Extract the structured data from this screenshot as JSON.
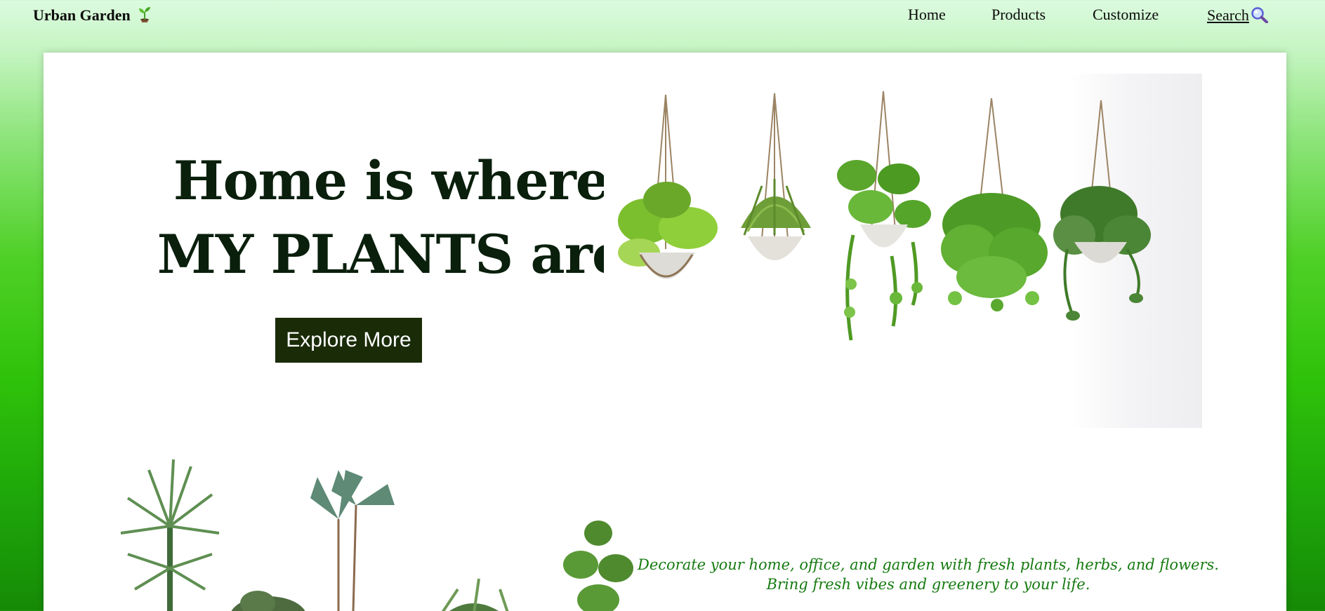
{
  "nav": {
    "brand": "Urban Garden",
    "links": [
      "Home",
      "Products",
      "Customize"
    ],
    "search_label": "Search"
  },
  "hero": {
    "headline_line1": "Home is where",
    "headline_line2": "MY PLANTS are",
    "cta_label": "Explore More"
  },
  "tagline": {
    "line1": "Decorate your home, office, and garden with fresh plants, herbs, and flowers.",
    "line2": "Bring fresh vibes and greenery to your life."
  },
  "colors": {
    "cta_background": "#1a2b08",
    "headline": "#0a1f0c",
    "tagline": "#157a10",
    "page_gradient_top": "#dcfbe0",
    "page_gradient_bottom": "#168a06"
  },
  "icons": [
    "sprout-icon",
    "magnifier-icon"
  ]
}
